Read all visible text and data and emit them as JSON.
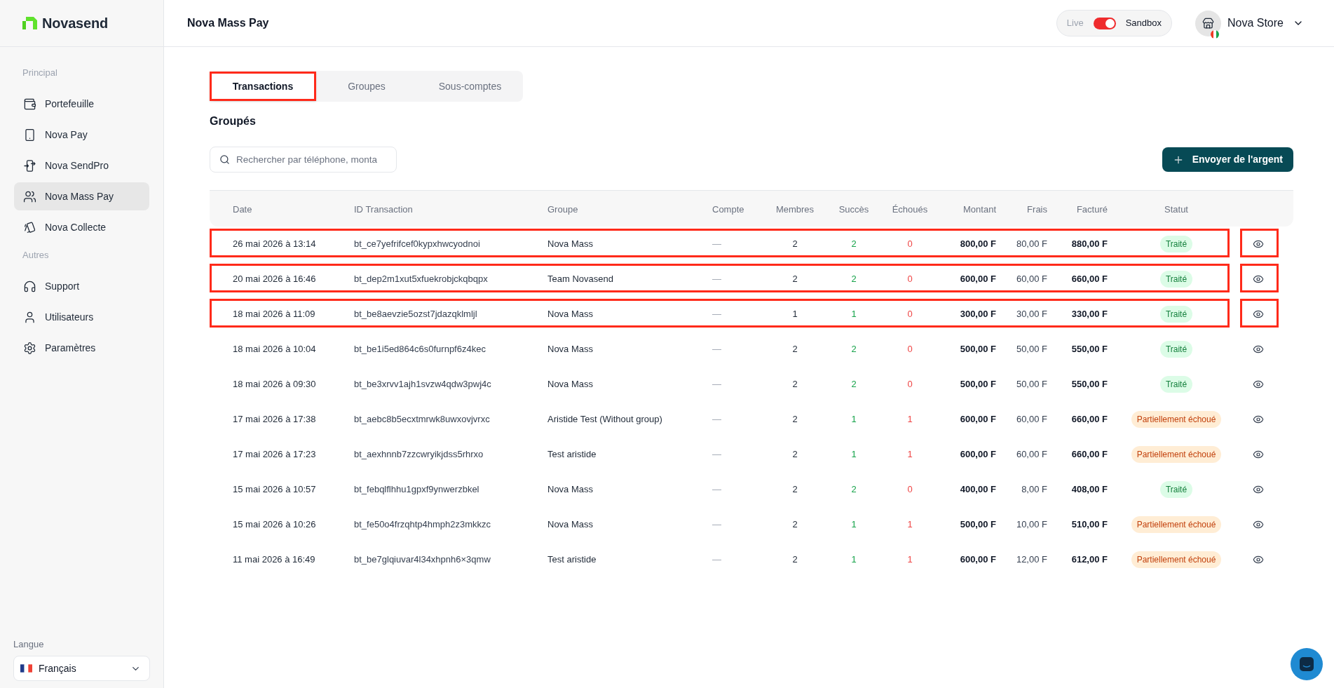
{
  "sidebar": {
    "brand": "Novasend",
    "sections": [
      {
        "title": "Principal",
        "items": [
          {
            "label": "Portefeuille",
            "selected": false
          },
          {
            "label": "Nova Pay",
            "selected": false
          },
          {
            "label": "Nova SendPro",
            "selected": false
          },
          {
            "label": "Nova Mass Pay",
            "selected": true
          },
          {
            "label": "Nova Collecte",
            "selected": false
          }
        ]
      },
      {
        "title": "Autres",
        "items": [
          {
            "label": "Support",
            "selected": false
          },
          {
            "label": "Utilisateurs",
            "selected": false
          },
          {
            "label": "Paramètres",
            "selected": false
          }
        ]
      }
    ],
    "language": {
      "label": "Langue",
      "value": "Français"
    }
  },
  "header": {
    "title": "Nova Mass Pay",
    "env_toggle": {
      "left_label": "Live",
      "right_label": "Sandbox",
      "on": true
    },
    "account": {
      "name": "Nova Store"
    }
  },
  "tabs": [
    {
      "label": "Transactions",
      "selected": true,
      "highlighted": true
    },
    {
      "label": "Groupes",
      "selected": false,
      "highlighted": false
    },
    {
      "label": "Sous-comptes",
      "selected": false,
      "highlighted": false
    }
  ],
  "section_title": "Groupés",
  "search": {
    "placeholder": "Rechercher par téléphone, monta"
  },
  "send_button": {
    "label": "Envoyer de l'argent"
  },
  "table": {
    "columns": [
      "Date",
      "ID Transaction",
      "Groupe",
      "Compte",
      "Membres",
      "Succès",
      "Échoués",
      "Montant",
      "Frais",
      "Facturé",
      "Statut"
    ],
    "rows": [
      {
        "date": "26 mai 2026 à 13:14",
        "id": "bt_ce7yefrifcef0kypxhwcyodnoi",
        "group": "Nova Mass",
        "account": "—",
        "members": "2",
        "success": "2",
        "failed": "0",
        "amount": "800,00 F",
        "fee": "80,00 F",
        "billed": "880,00 F",
        "status": {
          "label": "Traité",
          "kind": "success"
        },
        "highlighted": true
      },
      {
        "date": "20 mai 2026 à 16:46",
        "id": "bt_dep2m1xut5xfuekrobjckqbqpx",
        "group": "Team Novasend",
        "account": "—",
        "members": "2",
        "success": "2",
        "failed": "0",
        "amount": "600,00 F",
        "fee": "60,00 F",
        "billed": "660,00 F",
        "status": {
          "label": "Traité",
          "kind": "success"
        },
        "highlighted": true
      },
      {
        "date": "18 mai 2026 à 11:09",
        "id": "bt_be8aevzie5ozst7jdazqklmljl",
        "group": "Nova Mass",
        "account": "—",
        "members": "1",
        "success": "1",
        "failed": "0",
        "amount": "300,00 F",
        "fee": "30,00 F",
        "billed": "330,00 F",
        "status": {
          "label": "Traité",
          "kind": "success"
        },
        "highlighted": true
      },
      {
        "date": "18 mai 2026 à 10:04",
        "id": "bt_be1i5ed864c6s0furnpf6z4kec",
        "group": "Nova Mass",
        "account": "—",
        "members": "2",
        "success": "2",
        "failed": "0",
        "amount": "500,00 F",
        "fee": "50,00 F",
        "billed": "550,00 F",
        "status": {
          "label": "Traité",
          "kind": "success"
        },
        "highlighted": false
      },
      {
        "date": "18 mai 2026 à 09:30",
        "id": "bt_be3xrvv1ajh1svzw4qdw3pwj4c",
        "group": "Nova Mass",
        "account": "—",
        "members": "2",
        "success": "2",
        "failed": "0",
        "amount": "500,00 F",
        "fee": "50,00 F",
        "billed": "550,00 F",
        "status": {
          "label": "Traité",
          "kind": "success"
        },
        "highlighted": false
      },
      {
        "date": "17 mai 2026 à 17:38",
        "id": "bt_aebc8b5ecxtmrwk8uwxovjvrxc",
        "group": "Aristide Test (Without group)",
        "account": "—",
        "members": "2",
        "success": "1",
        "failed": "1",
        "amount": "600,00 F",
        "fee": "60,00 F",
        "billed": "660,00 F",
        "status": {
          "label": "Partiellement échoué",
          "kind": "partial"
        },
        "highlighted": false
      },
      {
        "date": "17 mai 2026 à 17:23",
        "id": "bt_aexhnnb7zzcwryikjdss5rhrxo",
        "group": "Test aristide",
        "account": "—",
        "members": "2",
        "success": "1",
        "failed": "1",
        "amount": "600,00 F",
        "fee": "60,00 F",
        "billed": "660,00 F",
        "status": {
          "label": "Partiellement échoué",
          "kind": "partial"
        },
        "highlighted": false
      },
      {
        "date": "15 mai 2026 à 10:57",
        "id": "bt_febqlflhhu1gpxf9ynwerzbkel",
        "group": "Nova Mass",
        "account": "—",
        "members": "2",
        "success": "2",
        "failed": "0",
        "amount": "400,00 F",
        "fee": "8,00 F",
        "billed": "408,00 F",
        "status": {
          "label": "Traité",
          "kind": "success"
        },
        "highlighted": false
      },
      {
        "date": "15 mai 2026 à 10:26",
        "id": "bt_fe50o4frzqhtp4hmph2z3mkkzc",
        "group": "Nova Mass",
        "account": "—",
        "members": "2",
        "success": "1",
        "failed": "1",
        "amount": "500,00 F",
        "fee": "10,00 F",
        "billed": "510,00 F",
        "status": {
          "label": "Partiellement échoué",
          "kind": "partial"
        },
        "highlighted": false
      },
      {
        "date": "11 mai 2026 à 16:49",
        "id": "bt_be7glqiuvar4l34xhpnh6×3qmw",
        "group": "Test aristide",
        "account": "—",
        "members": "2",
        "success": "1",
        "failed": "1",
        "amount": "600,00 F",
        "fee": "12,00 F",
        "billed": "612,00 F",
        "status": {
          "label": "Partiellement échoué",
          "kind": "partial"
        },
        "highlighted": false
      }
    ]
  }
}
